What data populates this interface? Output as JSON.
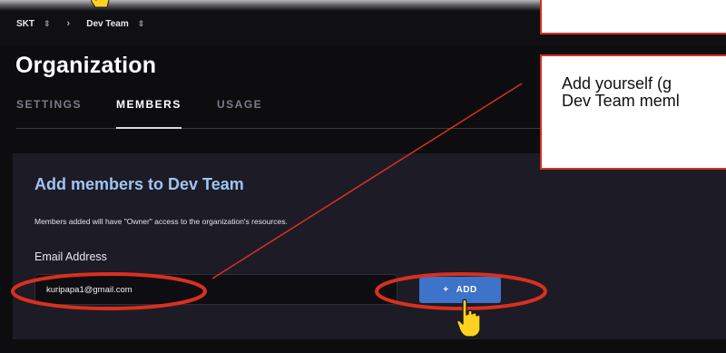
{
  "breadcrumb": {
    "org": "SKT",
    "team": "Dev Team"
  },
  "page": {
    "title": "Organization"
  },
  "tabs": [
    {
      "label": "SETTINGS",
      "active": false
    },
    {
      "label": "MEMBERS",
      "active": true
    },
    {
      "label": "USAGE",
      "active": false
    }
  ],
  "add_members": {
    "title": "Add members to Dev Team",
    "description": "Members added will have \"Owner\" access to the organization's resources.",
    "email_label": "Email Address",
    "email_value": "kuripapa1@gmail.com",
    "add_button_label": "ADD"
  },
  "annotation": {
    "callout_text": "Add yourself (g\nDev Team meml"
  },
  "colors": {
    "accent_blue": "#3d73c9",
    "title_blue": "#9fc5f2",
    "highlight_red": "#d9301e",
    "pointer_yellow": "#ffd21f"
  },
  "icons": {
    "breadcrumb_selector": "up-down-chevron-icon",
    "breadcrumb_separator": "chevron-right-icon",
    "add": "plus-icon",
    "pointer": "hand-pointer-icon"
  }
}
